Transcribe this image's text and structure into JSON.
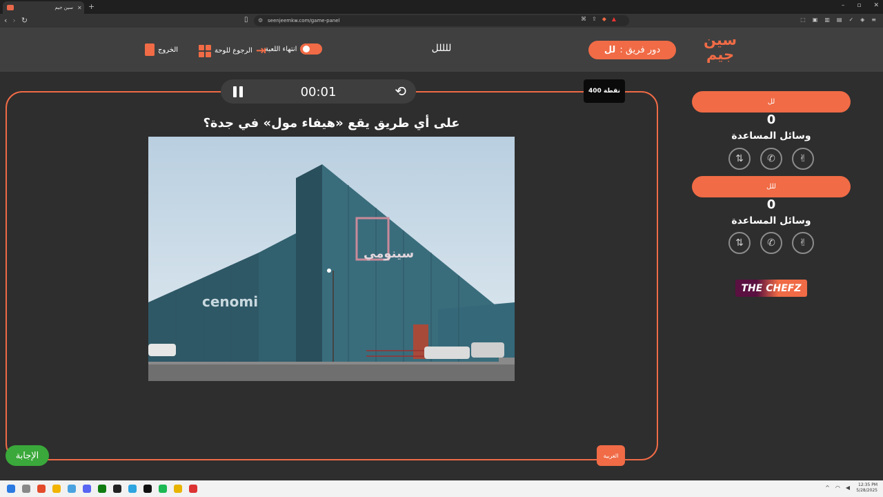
{
  "browser": {
    "tab_title": "سين جيم",
    "new_tab": "+",
    "url": "seenjeemkw.com/game-panel",
    "window_controls": [
      "–",
      "▫",
      "✕"
    ]
  },
  "header": {
    "logo_line1": "سين",
    "logo_line2": "جيم",
    "turn_label": "دور فريق :",
    "turn_team": "لل",
    "game_name": "للللل",
    "end_game_label": "انتهاء اللعبة",
    "back_to_board_label": "الرجوع للوحة",
    "exit_label": "الخروج"
  },
  "timer": {
    "time": "00:01"
  },
  "question": {
    "points": "400 نقطة",
    "text": "على أي طريق يقع «هيفاء مول» في جدة؟",
    "category": "الغربية",
    "answer_button": "الإجابة"
  },
  "teams": [
    {
      "name": "لل",
      "score": "0",
      "helps_label": "وسائل المساعدة"
    },
    {
      "name": "للل",
      "score": "0",
      "helps_label": "وسائل المساعدة"
    }
  ],
  "lifelines": [
    "swap-icon",
    "phone-icon",
    "double-answer-icon"
  ],
  "sponsor": {
    "text": "THE CHEFZ"
  },
  "photo_text": {
    "sign_left": "cenomi",
    "sign_right": "سينومي"
  },
  "taskbar": {
    "time": "12:35 PM",
    "date": "5/28/2025"
  },
  "colors": {
    "accent": "#f06b46",
    "answer": "#3aa83a",
    "background": "#2e2e2e"
  }
}
